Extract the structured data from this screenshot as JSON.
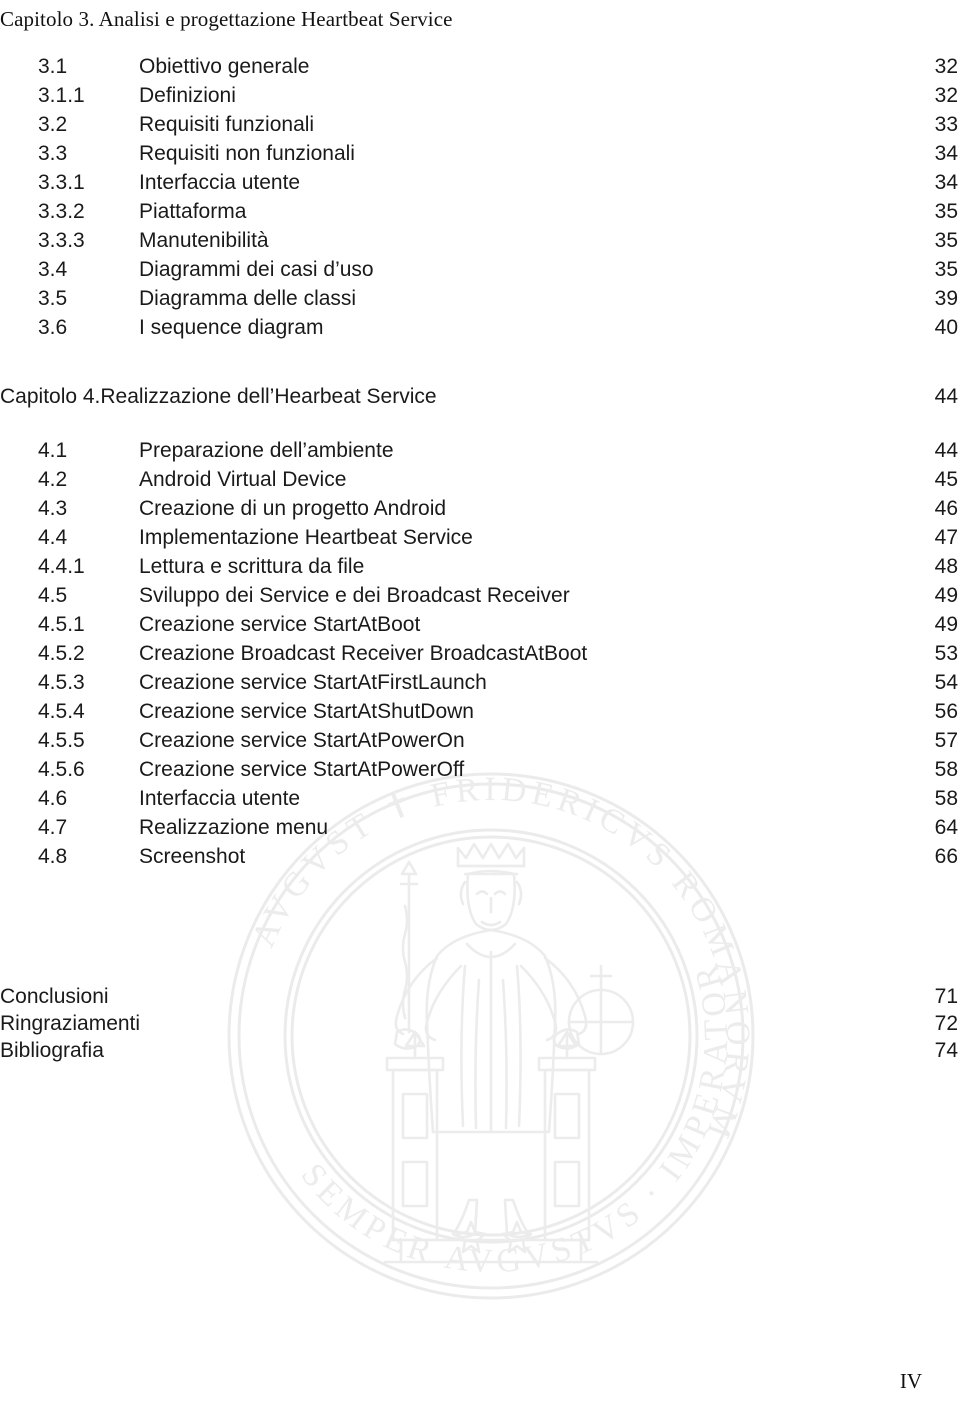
{
  "document": {
    "type": "table-of-contents",
    "language": "it",
    "folio": "IV",
    "background_color": "#ffffff",
    "text_color": "#1a1a1a",
    "watermark": {
      "name": "university-seal-watermark",
      "description": "Sigillo Universita degli Studi di Napoli Federico II",
      "color": "#ebebeb",
      "ring_text": "AVGVSTVS ✝ FRIDERICVS ROMANORVM IMPERATOR SEMPER AVGVSTVS"
    }
  },
  "chapter3": {
    "heading": "Capitolo 3. Analisi e progettazione Heartbeat Service",
    "entries": [
      {
        "number": "3.1",
        "label": "Obiettivo generale",
        "page": "32"
      },
      {
        "number": "3.1.1",
        "label": "Definizioni",
        "page": "32"
      },
      {
        "number": "3.2",
        "label": "Requisiti funzionali",
        "page": "33"
      },
      {
        "number": "3.3",
        "label": "Requisiti non funzionali",
        "page": "34"
      },
      {
        "number": "3.3.1",
        "label": "Interfaccia utente",
        "page": "34"
      },
      {
        "number": "3.3.2",
        "label": "Piattaforma",
        "page": "35"
      },
      {
        "number": "3.3.3",
        "label": "Manutenibilità",
        "page": "35"
      },
      {
        "number": "3.4",
        "label": "Diagrammi dei casi d’uso",
        "page": "35"
      },
      {
        "number": "3.5",
        "label": "Diagramma delle classi",
        "page": "39"
      },
      {
        "number": "3.6",
        "label": "I sequence diagram",
        "page": "40"
      }
    ]
  },
  "chapter4": {
    "heading": "Capitolo 4.Realizzazione dell’Hearbeat Service",
    "heading_page": "44",
    "entries": [
      {
        "number": "4.1",
        "label": "Preparazione dell’ambiente",
        "page": "44"
      },
      {
        "number": "4.2",
        "label": "Android Virtual Device",
        "page": "45"
      },
      {
        "number": "4.3",
        "label": "Creazione di un progetto Android",
        "page": "46"
      },
      {
        "number": "4.4",
        "label": "Implementazione Heartbeat Service",
        "page": "47"
      },
      {
        "number": "4.4.1",
        "label": "Lettura e scrittura da file",
        "page": "48"
      },
      {
        "number": "4.5",
        "label": "Sviluppo dei Service e dei Broadcast Receiver",
        "page": "49"
      },
      {
        "number": "4.5.1",
        "label": "Creazione service StartAtBoot",
        "page": "49"
      },
      {
        "number": "4.5.2",
        "label": "Creazione Broadcast Receiver BroadcastAtBoot",
        "page": "53"
      },
      {
        "number": "4.5.3",
        "label": "Creazione service StartAtFirstLaunch",
        "page": "54"
      },
      {
        "number": "4.5.4",
        "label": "Creazione service StartAtShutDown",
        "page": "56"
      },
      {
        "number": "4.5.5",
        "label": "Creazione service StartAtPowerOn",
        "page": "57"
      },
      {
        "number": "4.5.6",
        "label": "Creazione service StartAtPowerOff",
        "page": "58"
      },
      {
        "number": "4.6",
        "label": "Interfaccia utente",
        "page": "58"
      },
      {
        "number": "4.7",
        "label": "Realizzazione menu",
        "page": "64"
      },
      {
        "number": "4.8",
        "label": "Screenshot",
        "page": "66"
      }
    ]
  },
  "backmatter": {
    "entries": [
      {
        "label": "Conclusioni",
        "page": "71"
      },
      {
        "label": "Ringraziamenti",
        "page": "72"
      },
      {
        "label": "Bibliografia",
        "page": "74"
      }
    ]
  }
}
